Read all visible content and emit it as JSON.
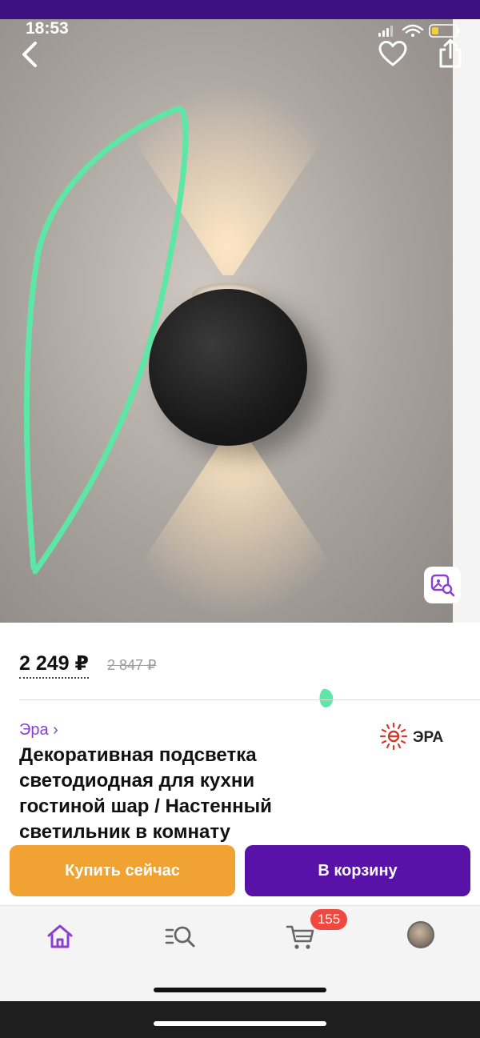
{
  "status_bar": {
    "time": "18:53"
  },
  "product": {
    "price": "2 249 ₽",
    "old_price": "2 847 ₽",
    "brand_link": "Эра ›",
    "brand_logo_text": "ЭРА",
    "title": "Декоративная подсветка светодиодная для кухни гостиной шар / Настенный светильник в комнату"
  },
  "actions": {
    "buy_now": "Купить сейчас",
    "add_to_cart": "В корзину"
  },
  "bottom_nav": {
    "items": [
      {
        "icon": "home-icon"
      },
      {
        "icon": "catalog-search-icon"
      },
      {
        "icon": "cart-icon",
        "badge": "155"
      },
      {
        "icon": "profile-avatar"
      }
    ]
  },
  "colors": {
    "accent_purple": "#5812a8",
    "buy_orange": "#f0a232",
    "badge_red": "#f0483e",
    "markup_green": "#5ee6a6"
  }
}
